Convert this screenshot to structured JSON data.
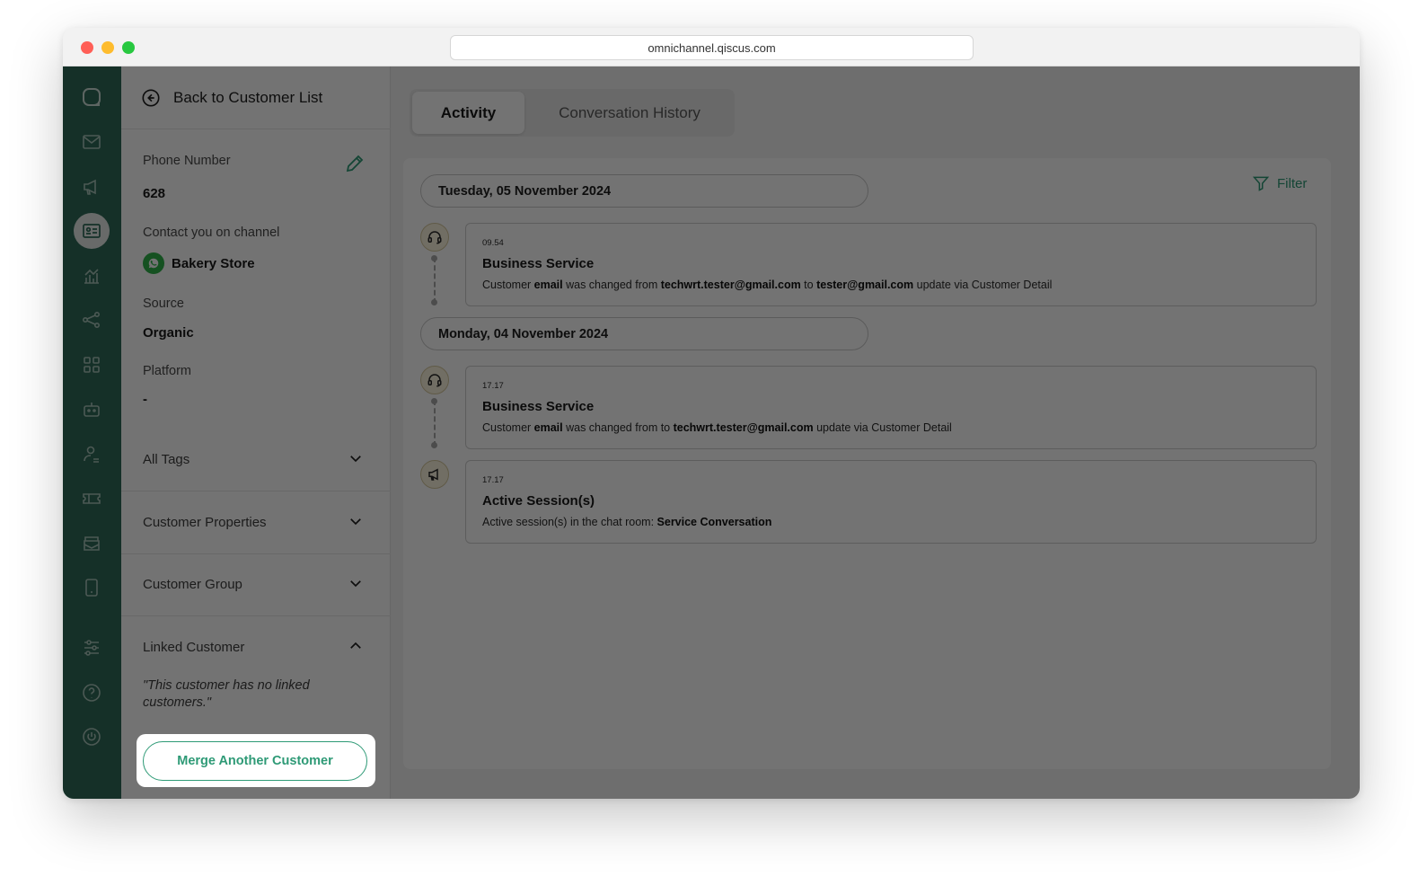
{
  "browser": {
    "url": "omnichannel.qiscus.com"
  },
  "nav_rail": {
    "icons": [
      "qiscus-logo-icon",
      "inbox-icon",
      "broadcast-icon",
      "customer-list-icon",
      "analytics-icon",
      "integration-icon",
      "apps-icon",
      "bot-icon",
      "agent-icon",
      "ticket-icon",
      "inbox-tray-icon",
      "mobile-icon",
      "settings-sliders-icon",
      "help-icon",
      "power-icon"
    ],
    "active": "customer-list-icon"
  },
  "sidebar": {
    "back_label": "Back to Customer List",
    "phone_label": "Phone Number",
    "phone_value": "628",
    "channel_label": "Contact you on channel",
    "channel_value": "Bakery Store",
    "source_label": "Source",
    "source_value": "Organic",
    "platform_label": "Platform",
    "platform_value": "-",
    "sections": [
      {
        "label": "All Tags",
        "expanded": false
      },
      {
        "label": "Customer Properties",
        "expanded": false
      },
      {
        "label": "Customer Group",
        "expanded": false
      },
      {
        "label": "Linked Customer",
        "expanded": true
      }
    ],
    "linked_empty": "\"This customer has no linked customers.\"",
    "merge_button": "Merge Another Customer"
  },
  "main": {
    "tabs": [
      {
        "label": "Activity",
        "active": true
      },
      {
        "label": "Conversation History",
        "active": false
      }
    ],
    "filter_label": "Filter",
    "days": [
      {
        "date": "Tuesday, 05 November 2024",
        "events": [
          {
            "icon": "headset-icon",
            "time": "09.54",
            "title": "Business Service",
            "desc_parts": [
              "Customer ",
              "email",
              " was changed from ",
              "techwrt.tester@gmail.com",
              " to ",
              "tester@gmail.com",
              " update via Customer Detail"
            ]
          }
        ]
      },
      {
        "date": "Monday, 04 November 2024",
        "events": [
          {
            "icon": "headset-icon",
            "time": "17.17",
            "title": "Business Service",
            "desc_parts": [
              "Customer ",
              "email",
              " was changed from to ",
              "techwrt.tester@gmail.com",
              " update via Customer Detail"
            ]
          },
          {
            "icon": "megaphone-icon",
            "time": "17.17",
            "title": "Active Session(s)",
            "desc_parts": [
              "Active session(s) in the chat room: ",
              "Service Conversation"
            ]
          }
        ]
      }
    ]
  },
  "colors": {
    "rail": "#2f6c5a",
    "accent": "#2e9a76",
    "overlay": "rgba(0,0,0,0.55)"
  }
}
